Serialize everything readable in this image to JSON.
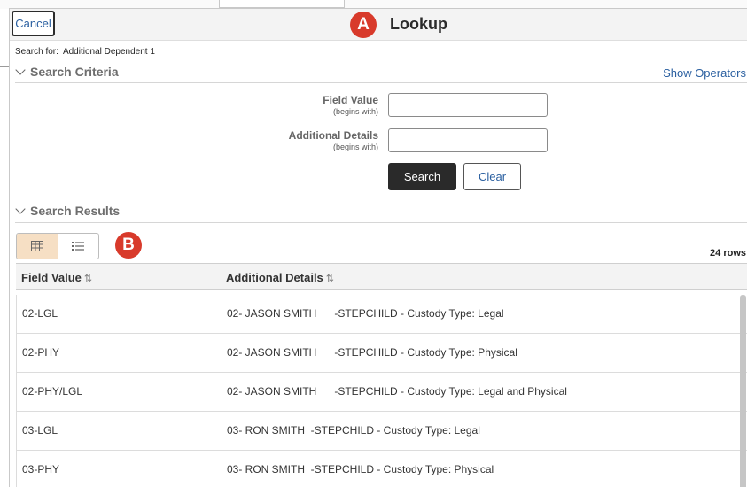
{
  "dialog": {
    "cancel_label": "Cancel",
    "title": "Lookup",
    "search_for_label": "Search for:",
    "search_for_value": "Additional Dependent 1"
  },
  "callouts": {
    "a": "A",
    "b": "B"
  },
  "search_criteria": {
    "heading": "Search Criteria",
    "show_operators": "Show Operators",
    "fields": [
      {
        "label": "Field Value",
        "qualifier": "(begins with)",
        "value": ""
      },
      {
        "label": "Additional Details",
        "qualifier": "(begins with)",
        "value": ""
      }
    ],
    "search_button": "Search",
    "clear_button": "Clear"
  },
  "search_results": {
    "heading": "Search Results",
    "view_modes": [
      "grid-view-icon",
      "list-view-icon"
    ],
    "active_view": "grid-view-icon",
    "rows_count": "24 rows",
    "columns": [
      "Field Value",
      "Additional Details"
    ],
    "sort_icon": "sort-updown-icon",
    "rows": [
      {
        "field_value": "02-LGL",
        "details": "02- JASON SMITH      -STEPCHILD - Custody Type: Legal"
      },
      {
        "field_value": "02-PHY",
        "details": "02- JASON SMITH      -STEPCHILD - Custody Type: Physical"
      },
      {
        "field_value": "02-PHY/LGL",
        "details": "02- JASON SMITH      -STEPCHILD - Custody Type: Legal and Physical"
      },
      {
        "field_value": "03-LGL",
        "details": "03- RON SMITH  -STEPCHILD - Custody Type: Legal"
      },
      {
        "field_value": "03-PHY",
        "details": "03- RON SMITH  -STEPCHILD - Custody Type: Physical"
      }
    ]
  },
  "colors": {
    "accent": "#2a5fa0",
    "callout": "#d83a2b",
    "search_button_bg": "#2a2a2a",
    "active_toggle": "#f6dfc4"
  }
}
